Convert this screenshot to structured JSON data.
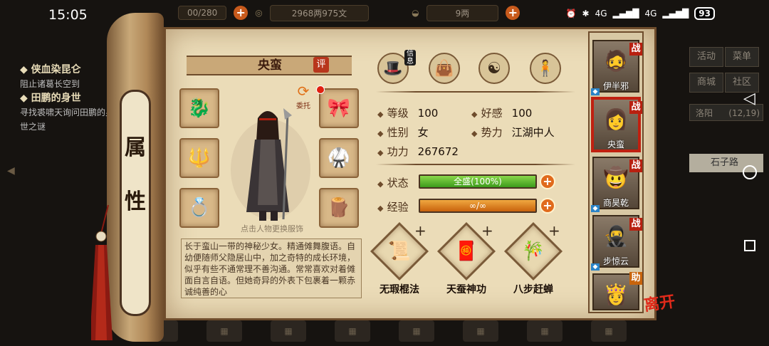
{
  "status_bar": {
    "time": "15:05",
    "battery": "93",
    "signal_1": "4G",
    "signal_2": "4G"
  },
  "top_bar": {
    "stamina": "00/280",
    "copper": "2968两975文",
    "ingots": "9两",
    "right_time": "15:05"
  },
  "quests": [
    {
      "title": "侠血染昆仑",
      "desc": "阻止诸葛长空到"
    },
    {
      "title": "田鹏的身世",
      "desc": "寻找裘啸天询问田鹏的身世之谜"
    }
  ],
  "right_menu": {
    "buttons": [
      "活动",
      "菜单",
      "商城",
      "社区"
    ],
    "location": "洛阳",
    "coords": "(12,19)",
    "road": "石子路"
  },
  "scroll_title": [
    "属",
    "性"
  ],
  "character": {
    "name": "央蛮",
    "rate_label": "评",
    "entrust_label": "委托",
    "outfit_hint": "点击人物更换服饰",
    "description": "长于蛮山一带的神秘少女。精通傩舞腹语。自幼便随师父隐居山中，加之奇特的成长环境，似乎有些不通常理不善沟通。常常喜欢对着傩面自言自语。但她奇异的外表下包裹着一颗赤诚纯善的心"
  },
  "tabs": {
    "info_label": "信息",
    "icons": [
      "info-icon",
      "bag-icon",
      "bagua-icon",
      "meridian-icon"
    ]
  },
  "stats": {
    "level_label": "等级",
    "level": "100",
    "favor_label": "好感",
    "favor": "100",
    "gender_label": "性别",
    "gender": "女",
    "faction_label": "势力",
    "faction": "江湖中人",
    "power_label": "功力",
    "power": "267672",
    "state_label": "状态",
    "state_value": "全盛(100%)",
    "state_fraction": 1.0,
    "exp_label": "经验",
    "exp_value": "∞/∞",
    "exp_fraction": 1.0
  },
  "skills": [
    {
      "name": "无瑕棍法",
      "icon": "staff-icon"
    },
    {
      "name": "天蚕神功",
      "icon": "silkworm-scroll-icon"
    },
    {
      "name": "八步赶蝉",
      "icon": "cicada-scroll-icon"
    }
  ],
  "party": [
    {
      "name": "伊半邪",
      "tag": "战"
    },
    {
      "name": "央蛮",
      "tag": "战"
    },
    {
      "name": "商昊乾",
      "tag": "战"
    },
    {
      "name": "步惊云",
      "tag": "战"
    },
    {
      "name": "",
      "tag": "助"
    }
  ],
  "leave_label": "离开",
  "plus": "+"
}
